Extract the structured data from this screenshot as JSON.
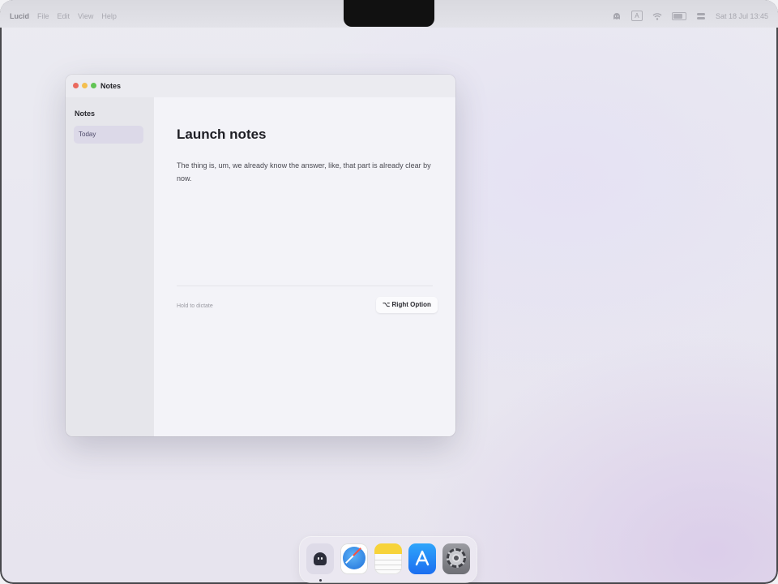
{
  "menubar": {
    "app_name": "Lucid",
    "items": [
      "File",
      "Edit",
      "View",
      "Help"
    ],
    "status_icons": [
      "ghost-icon",
      "input-source-icon",
      "wifi-icon",
      "battery-icon",
      "control-center-icon"
    ],
    "input_source": "A",
    "clock": "Sat 18 Jul 13:45"
  },
  "window": {
    "title": "Notes",
    "sidebar": {
      "heading": "Notes",
      "items": [
        {
          "label": "Today",
          "selected": true
        }
      ]
    },
    "note": {
      "title": "Launch notes",
      "body": "The thing is, um, we already know the answer, like, that part is already clear by now."
    },
    "footer": {
      "hint": "Hold to dictate",
      "key_label": "⌥ Right Option"
    }
  },
  "dock": {
    "apps": [
      {
        "name": "ghost-app-icon",
        "running": true
      },
      {
        "name": "safari-icon",
        "running": false
      },
      {
        "name": "notes-icon",
        "running": false
      },
      {
        "name": "app-store-icon",
        "running": false
      },
      {
        "name": "system-settings-icon",
        "running": false
      }
    ]
  },
  "colors": {
    "traffic_red": "#ea6a5e",
    "traffic_yellow": "#f4bf4f",
    "traffic_green": "#61c454",
    "sidebar_selection": "#dcd9e8"
  }
}
